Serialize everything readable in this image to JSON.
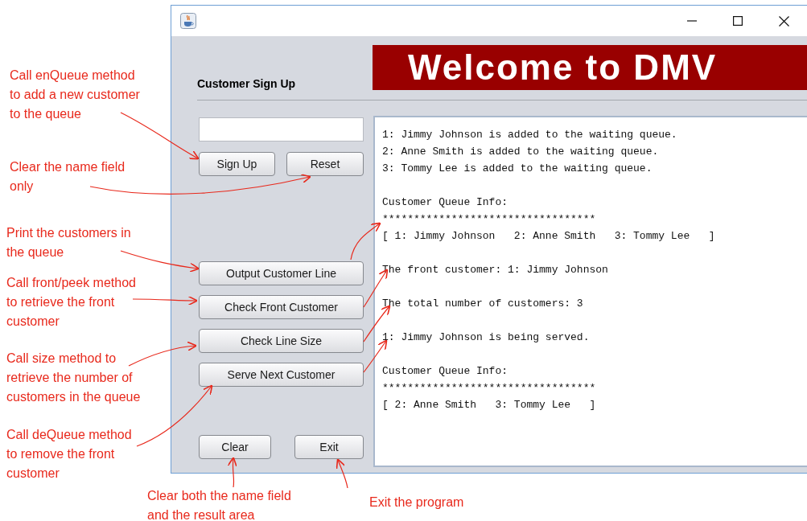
{
  "annotations": [
    {
      "lines": [
        "Call enQueue method",
        "to add a new customer",
        "to the queue"
      ]
    },
    {
      "lines": [
        "Clear the name field",
        "only"
      ]
    },
    {
      "lines": [
        "Print the customers in",
        "the queue"
      ]
    },
    {
      "lines": [
        "Call front/peek method",
        "to retrieve the front",
        "customer"
      ]
    },
    {
      "lines": [
        "Call size method to",
        "retrieve the number of",
        "customers in the queue"
      ]
    },
    {
      "lines": [
        "Call deQueue method",
        "to remove the front",
        "customer"
      ]
    },
    {
      "lines": [
        "Clear both the name field",
        "and the result area"
      ]
    },
    {
      "lines": [
        "Exit the program"
      ]
    }
  ],
  "window": {
    "section_label": "Customer Sign Up",
    "banner": "Welcome to DMV",
    "signup_buttons": [
      {
        "label": "Sign Up"
      },
      {
        "label": "Reset"
      }
    ],
    "action_buttons": [
      {
        "label": "Output Customer Line"
      },
      {
        "label": "Check Front Customer"
      },
      {
        "label": "Check Line Size"
      },
      {
        "label": "Serve Next Customer"
      }
    ],
    "bottom_buttons": [
      {
        "label": "Clear"
      },
      {
        "label": "Exit"
      }
    ],
    "output": [
      {
        "lines": [
          "1: Jimmy Johnson is added to the waiting queue.",
          "2: Anne Smith is added to the waiting queue.",
          "3: Tommy Lee is added to the waiting queue."
        ]
      },
      {
        "lines": [
          "Customer Queue Info:",
          "**********************************",
          "[ 1: Jimmy Johnson   2: Anne Smith   3: Tommy Lee   ]"
        ]
      },
      {
        "lines": [
          "The front customer: 1: Jimmy Johnson"
        ]
      },
      {
        "lines": [
          "The total number of customers: 3"
        ]
      },
      {
        "lines": [
          "1: Jimmy Johnson is being served."
        ]
      },
      {
        "lines": [
          "Customer Queue Info:",
          "**********************************",
          "[ 2: Anne Smith   3: Tommy Lee   ]"
        ]
      }
    ]
  }
}
